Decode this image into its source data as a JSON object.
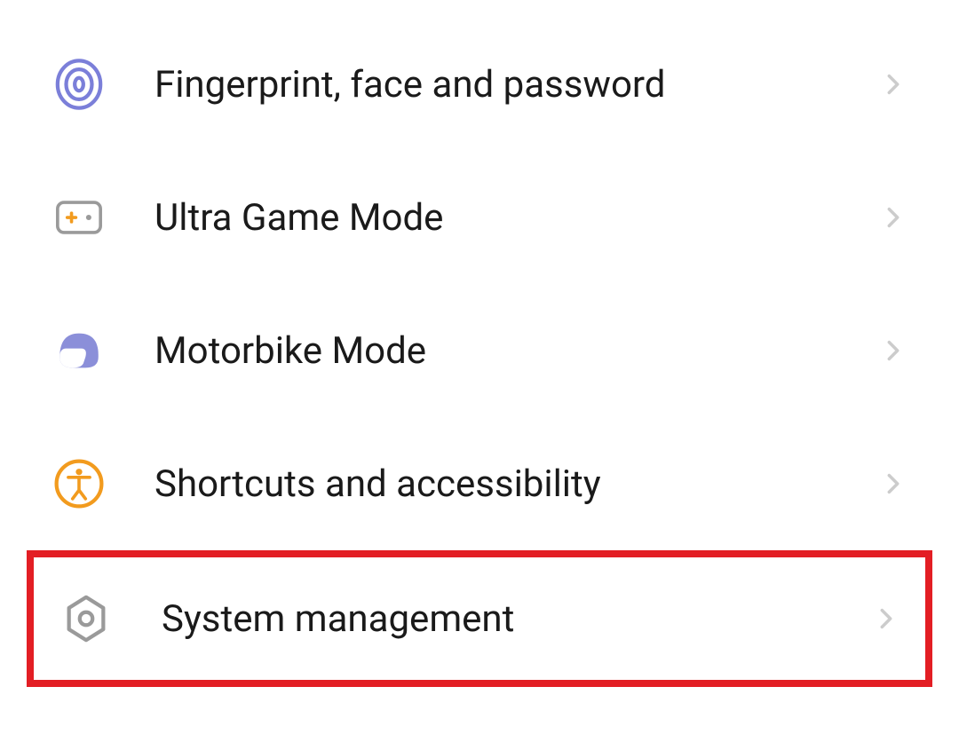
{
  "settings": {
    "items": [
      {
        "label": "Fingerprint, face and password",
        "icon": "fingerprint-icon",
        "highlighted": false
      },
      {
        "label": "Ultra Game Mode",
        "icon": "game-icon",
        "highlighted": false
      },
      {
        "label": "Motorbike Mode",
        "icon": "helmet-icon",
        "highlighted": false
      },
      {
        "label": "Shortcuts and accessibility",
        "icon": "accessibility-icon",
        "highlighted": false
      },
      {
        "label": "System management",
        "icon": "hexagon-gear-icon",
        "highlighted": true
      }
    ]
  },
  "colors": {
    "purple": "#7b7fd9",
    "orange": "#f29b1e",
    "gray": "#9a9a9a",
    "chevron": "#cccccc",
    "highlight": "#e31e24"
  }
}
